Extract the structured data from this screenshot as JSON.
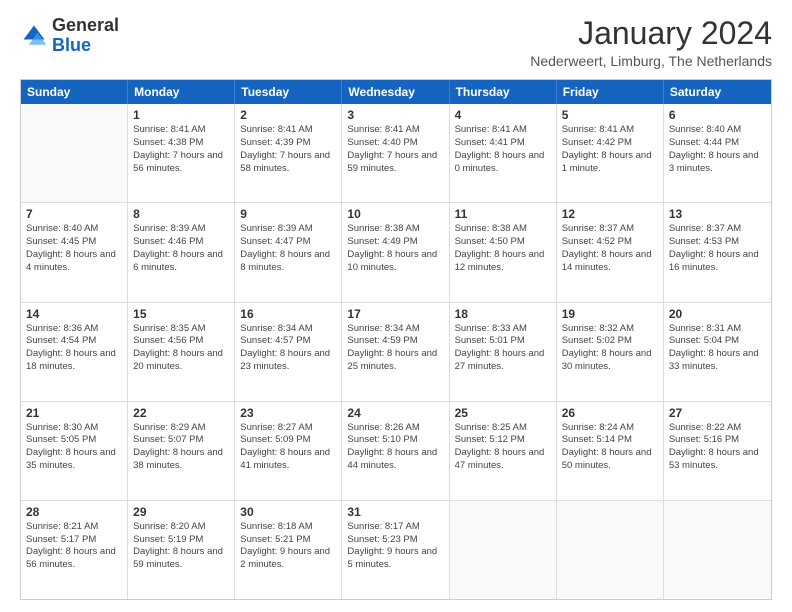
{
  "logo": {
    "general": "General",
    "blue": "Blue"
  },
  "title": "January 2024",
  "location": "Nederweert, Limburg, The Netherlands",
  "calendar": {
    "headers": [
      "Sunday",
      "Monday",
      "Tuesday",
      "Wednesday",
      "Thursday",
      "Friday",
      "Saturday"
    ],
    "rows": [
      [
        {
          "day": "",
          "sunrise": "",
          "sunset": "",
          "daylight": ""
        },
        {
          "day": "1",
          "sunrise": "Sunrise: 8:41 AM",
          "sunset": "Sunset: 4:38 PM",
          "daylight": "Daylight: 7 hours and 56 minutes."
        },
        {
          "day": "2",
          "sunrise": "Sunrise: 8:41 AM",
          "sunset": "Sunset: 4:39 PM",
          "daylight": "Daylight: 7 hours and 58 minutes."
        },
        {
          "day": "3",
          "sunrise": "Sunrise: 8:41 AM",
          "sunset": "Sunset: 4:40 PM",
          "daylight": "Daylight: 7 hours and 59 minutes."
        },
        {
          "day": "4",
          "sunrise": "Sunrise: 8:41 AM",
          "sunset": "Sunset: 4:41 PM",
          "daylight": "Daylight: 8 hours and 0 minutes."
        },
        {
          "day": "5",
          "sunrise": "Sunrise: 8:41 AM",
          "sunset": "Sunset: 4:42 PM",
          "daylight": "Daylight: 8 hours and 1 minute."
        },
        {
          "day": "6",
          "sunrise": "Sunrise: 8:40 AM",
          "sunset": "Sunset: 4:44 PM",
          "daylight": "Daylight: 8 hours and 3 minutes."
        }
      ],
      [
        {
          "day": "7",
          "sunrise": "Sunrise: 8:40 AM",
          "sunset": "Sunset: 4:45 PM",
          "daylight": "Daylight: 8 hours and 4 minutes."
        },
        {
          "day": "8",
          "sunrise": "Sunrise: 8:39 AM",
          "sunset": "Sunset: 4:46 PM",
          "daylight": "Daylight: 8 hours and 6 minutes."
        },
        {
          "day": "9",
          "sunrise": "Sunrise: 8:39 AM",
          "sunset": "Sunset: 4:47 PM",
          "daylight": "Daylight: 8 hours and 8 minutes."
        },
        {
          "day": "10",
          "sunrise": "Sunrise: 8:38 AM",
          "sunset": "Sunset: 4:49 PM",
          "daylight": "Daylight: 8 hours and 10 minutes."
        },
        {
          "day": "11",
          "sunrise": "Sunrise: 8:38 AM",
          "sunset": "Sunset: 4:50 PM",
          "daylight": "Daylight: 8 hours and 12 minutes."
        },
        {
          "day": "12",
          "sunrise": "Sunrise: 8:37 AM",
          "sunset": "Sunset: 4:52 PM",
          "daylight": "Daylight: 8 hours and 14 minutes."
        },
        {
          "day": "13",
          "sunrise": "Sunrise: 8:37 AM",
          "sunset": "Sunset: 4:53 PM",
          "daylight": "Daylight: 8 hours and 16 minutes."
        }
      ],
      [
        {
          "day": "14",
          "sunrise": "Sunrise: 8:36 AM",
          "sunset": "Sunset: 4:54 PM",
          "daylight": "Daylight: 8 hours and 18 minutes."
        },
        {
          "day": "15",
          "sunrise": "Sunrise: 8:35 AM",
          "sunset": "Sunset: 4:56 PM",
          "daylight": "Daylight: 8 hours and 20 minutes."
        },
        {
          "day": "16",
          "sunrise": "Sunrise: 8:34 AM",
          "sunset": "Sunset: 4:57 PM",
          "daylight": "Daylight: 8 hours and 23 minutes."
        },
        {
          "day": "17",
          "sunrise": "Sunrise: 8:34 AM",
          "sunset": "Sunset: 4:59 PM",
          "daylight": "Daylight: 8 hours and 25 minutes."
        },
        {
          "day": "18",
          "sunrise": "Sunrise: 8:33 AM",
          "sunset": "Sunset: 5:01 PM",
          "daylight": "Daylight: 8 hours and 27 minutes."
        },
        {
          "day": "19",
          "sunrise": "Sunrise: 8:32 AM",
          "sunset": "Sunset: 5:02 PM",
          "daylight": "Daylight: 8 hours and 30 minutes."
        },
        {
          "day": "20",
          "sunrise": "Sunrise: 8:31 AM",
          "sunset": "Sunset: 5:04 PM",
          "daylight": "Daylight: 8 hours and 33 minutes."
        }
      ],
      [
        {
          "day": "21",
          "sunrise": "Sunrise: 8:30 AM",
          "sunset": "Sunset: 5:05 PM",
          "daylight": "Daylight: 8 hours and 35 minutes."
        },
        {
          "day": "22",
          "sunrise": "Sunrise: 8:29 AM",
          "sunset": "Sunset: 5:07 PM",
          "daylight": "Daylight: 8 hours and 38 minutes."
        },
        {
          "day": "23",
          "sunrise": "Sunrise: 8:27 AM",
          "sunset": "Sunset: 5:09 PM",
          "daylight": "Daylight: 8 hours and 41 minutes."
        },
        {
          "day": "24",
          "sunrise": "Sunrise: 8:26 AM",
          "sunset": "Sunset: 5:10 PM",
          "daylight": "Daylight: 8 hours and 44 minutes."
        },
        {
          "day": "25",
          "sunrise": "Sunrise: 8:25 AM",
          "sunset": "Sunset: 5:12 PM",
          "daylight": "Daylight: 8 hours and 47 minutes."
        },
        {
          "day": "26",
          "sunrise": "Sunrise: 8:24 AM",
          "sunset": "Sunset: 5:14 PM",
          "daylight": "Daylight: 8 hours and 50 minutes."
        },
        {
          "day": "27",
          "sunrise": "Sunrise: 8:22 AM",
          "sunset": "Sunset: 5:16 PM",
          "daylight": "Daylight: 8 hours and 53 minutes."
        }
      ],
      [
        {
          "day": "28",
          "sunrise": "Sunrise: 8:21 AM",
          "sunset": "Sunset: 5:17 PM",
          "daylight": "Daylight: 8 hours and 56 minutes."
        },
        {
          "day": "29",
          "sunrise": "Sunrise: 8:20 AM",
          "sunset": "Sunset: 5:19 PM",
          "daylight": "Daylight: 8 hours and 59 minutes."
        },
        {
          "day": "30",
          "sunrise": "Sunrise: 8:18 AM",
          "sunset": "Sunset: 5:21 PM",
          "daylight": "Daylight: 9 hours and 2 minutes."
        },
        {
          "day": "31",
          "sunrise": "Sunrise: 8:17 AM",
          "sunset": "Sunset: 5:23 PM",
          "daylight": "Daylight: 9 hours and 5 minutes."
        },
        {
          "day": "",
          "sunrise": "",
          "sunset": "",
          "daylight": ""
        },
        {
          "day": "",
          "sunrise": "",
          "sunset": "",
          "daylight": ""
        },
        {
          "day": "",
          "sunrise": "",
          "sunset": "",
          "daylight": ""
        }
      ]
    ]
  }
}
